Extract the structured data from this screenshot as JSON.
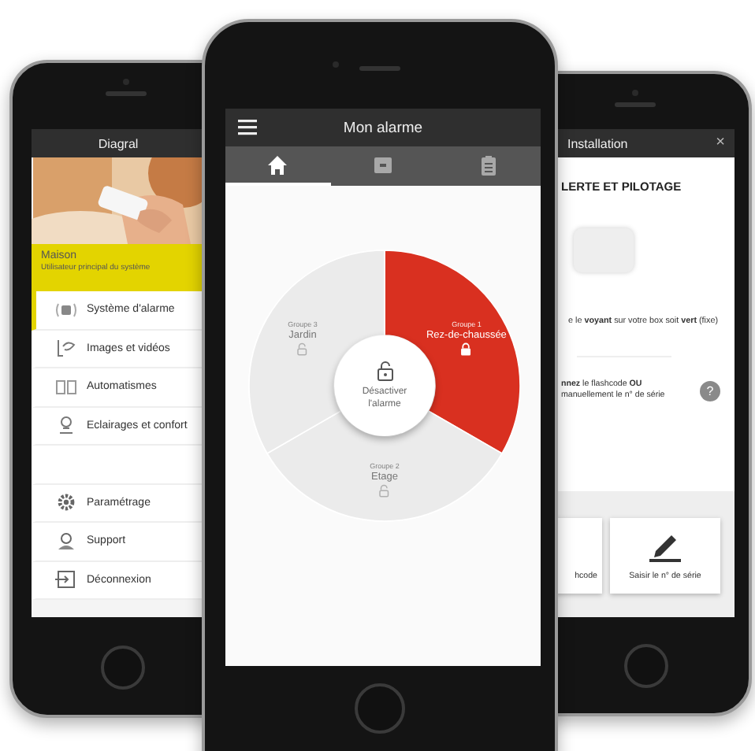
{
  "menu_screen": {
    "title": "Diagral",
    "account": {
      "name": "Maison",
      "role": "Utilisateur principal du système"
    },
    "items": [
      {
        "kind": "alarm",
        "label": "Système d'alarme",
        "selected": true
      },
      {
        "kind": "camera",
        "label": "Images et vidéos",
        "selected": false
      },
      {
        "kind": "automation",
        "label": "Automatismes",
        "selected": false
      },
      {
        "kind": "light",
        "label": "Eclairages et confort",
        "selected": false
      },
      {
        "kind": "blank"
      },
      {
        "kind": "gear",
        "label": "Paramétrage",
        "selected": false
      },
      {
        "kind": "support",
        "label": "Support",
        "selected": false
      },
      {
        "kind": "logout",
        "label": "Déconnexion",
        "selected": false
      }
    ]
  },
  "alarm_screen": {
    "title": "Mon alarme",
    "tabs": [
      {
        "kind": "home",
        "selected": true
      },
      {
        "kind": "box",
        "selected": false
      },
      {
        "kind": "clipboard",
        "selected": false
      }
    ],
    "groups": [
      {
        "group": "Groupe 1",
        "name": "Rez-de-chaussée",
        "armed": true
      },
      {
        "group": "Groupe 2",
        "name": "Etage",
        "armed": false
      },
      {
        "group": "Groupe 3",
        "name": "Jardin",
        "armed": false
      }
    ],
    "center_action": "Désactiver l'alarme"
  },
  "install_screen": {
    "title": "Installation",
    "close": "×",
    "heading": "LERTE ET PILOTAGE",
    "step_1": "e le **voyant** sur votre box soit **vert** (fixe)",
    "step_2": "**nnez** le flashcode **OU** manuellement le n° de série",
    "help": "?",
    "buttons": [
      {
        "kind": "scan",
        "label": "hcode"
      },
      {
        "kind": "edit",
        "label": "Saisir le n° de série"
      }
    ]
  }
}
